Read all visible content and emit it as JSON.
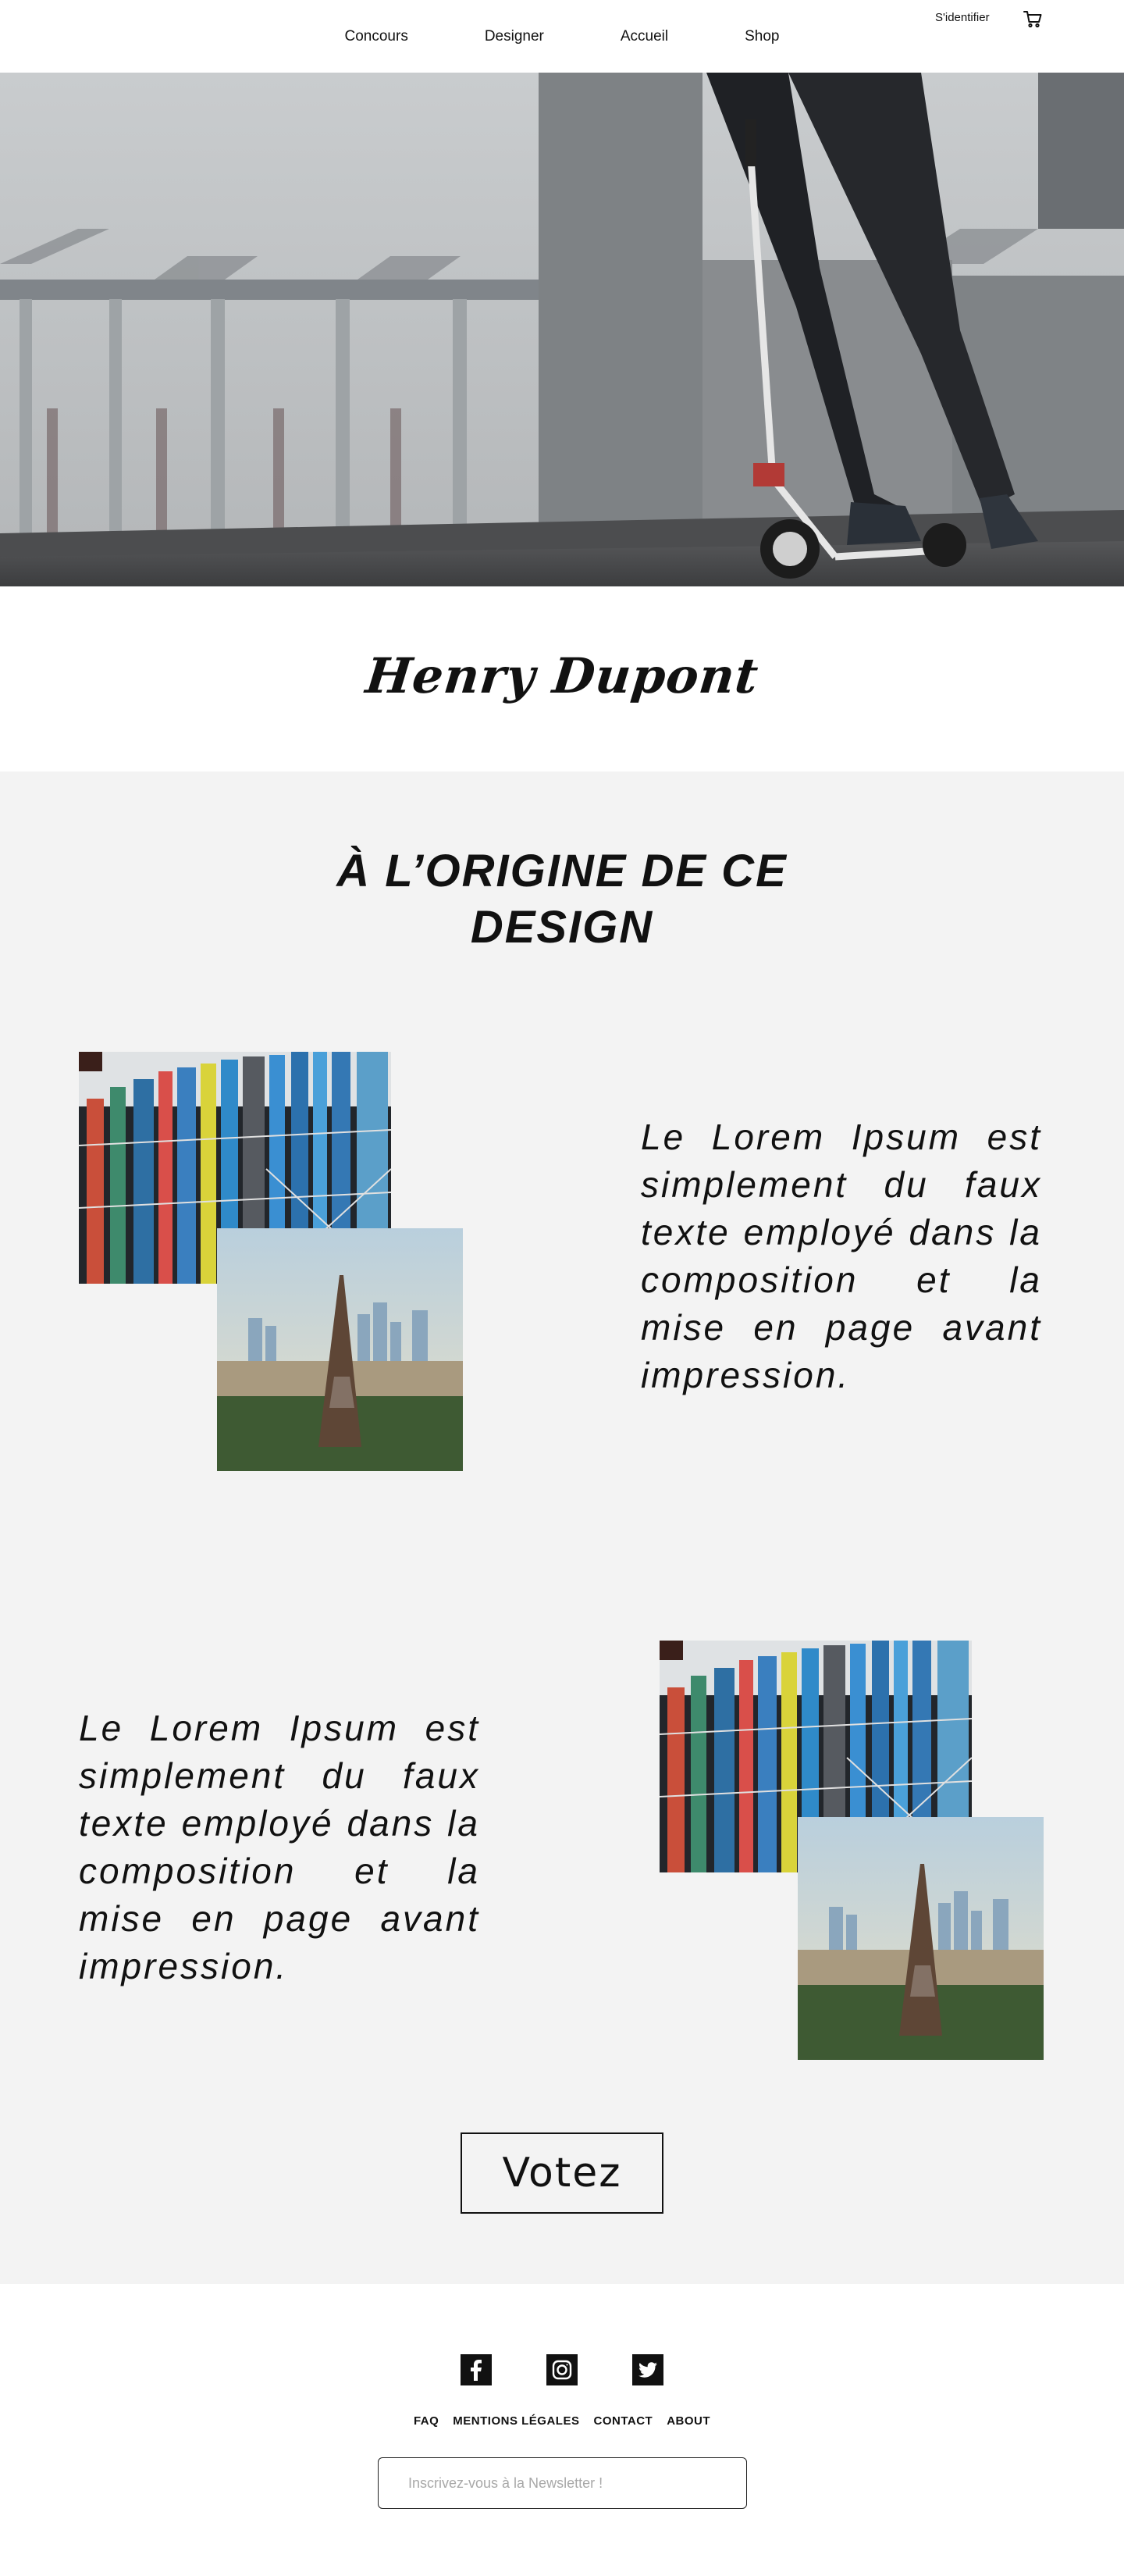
{
  "header": {
    "nav": [
      "Concours",
      "Designer",
      "Accueil",
      "Shop"
    ],
    "login_label": "S'identifier",
    "cart_icon": "cart-icon"
  },
  "hero": {
    "image": "person-riding-scooter-photo"
  },
  "designer": {
    "name": "Henry Dupont"
  },
  "origin": {
    "title_line1": "À L’ORIGINE DE CE",
    "title_line2": "DESIGN",
    "block1_text": "Le Lorem Ipsum est simplement du faux texte employé dans la composition et la mise en page avant impression.",
    "block2_text": "Le Lorem Ipsum est simplement du faux texte employé dans la composition et la mise en page avant impression.",
    "images": [
      "centre-pompidou-photo",
      "eiffel-tower-photo"
    ]
  },
  "vote": {
    "label": "Votez"
  },
  "footer": {
    "social": [
      "facebook-icon",
      "instagram-icon",
      "twitter-icon"
    ],
    "links": [
      "FAQ",
      "MENTIONS LÉGALES",
      "CONTACT",
      "ABOUT"
    ],
    "newsletter_placeholder": "Inscrivez-vous à la Newsletter !"
  },
  "colors": {
    "section_bg": "#f3f3f3",
    "text": "#111111",
    "page_bg": "#ffffff"
  }
}
